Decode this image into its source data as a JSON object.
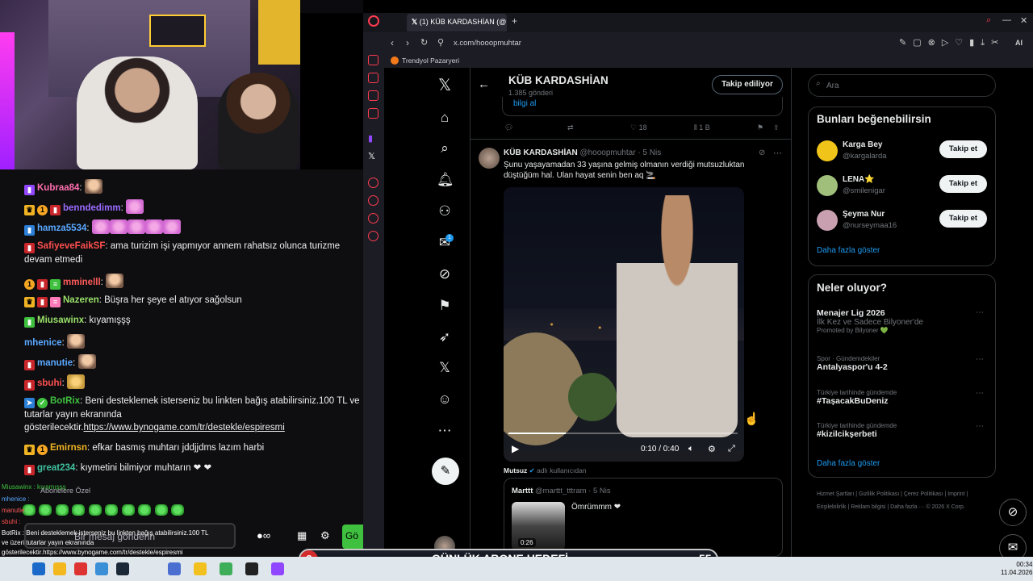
{
  "browser": {
    "tab_title": "(1) KÜB KARDASHİAN (@h",
    "url": "x.com/hooopmuhtar",
    "bookmark": "Trendyol Pazaryeri"
  },
  "profile": {
    "name": "KÜB KARDASHİAN",
    "posts": "1.385 gönderi",
    "follow_label": "Takip ediliyor",
    "prev_link": "bilgi al",
    "prev_likes": "18",
    "prev_views": "1 B"
  },
  "tweet": {
    "author": "KÜB KARDASHİAN",
    "handle": "@hooopmuhtar",
    "time": "· 5 Nis",
    "text": "Şunu yaşayamadan 33 yaşına gelmiş olmanın verdiği mutsuzluktan düştüğüm hal. Ulan hayat senin ben aq 🚬",
    "video_time": "0:10 / 0:40",
    "progress": 0.25
  },
  "quoted": {
    "label": "Mutsuz",
    "label_suffix": "adlı kullanıcıdan",
    "author": "Marttt",
    "handle": "@marttt_tttram",
    "time": "· 5 Nis",
    "text": "Ömrümmm ❤",
    "duration": "0:26"
  },
  "search": {
    "placeholder": "Ara"
  },
  "who_to_follow": {
    "title": "Bunları beğenebilirsin",
    "items": [
      {
        "name": "Karga Bey",
        "handle": "@kargalarda",
        "button": "Takip et",
        "color": "#f0c419"
      },
      {
        "name": "LENA⭐",
        "handle": "@smilenigar",
        "button": "Takip et",
        "color": "#9fbf7a"
      },
      {
        "name": "Şeyma Nur",
        "handle": "@nurseymaa16",
        "button": "Takip et",
        "color": "#c9a0b0"
      }
    ],
    "more": "Daha fazla göster"
  },
  "trends": {
    "title": "Neler oluyor?",
    "items": [
      {
        "context": "",
        "title": "Menajer Lig 2026",
        "sub": "İlk Kez ve Sadece Bilyoner'de",
        "extra": "Promoted by Bilyoner 💚"
      },
      {
        "context": "Spor · Gündemdekiler",
        "title": "Antalyaspor'u 4-2",
        "sub": "",
        "extra": ""
      },
      {
        "context": "Türkiye tarihinde gündemde",
        "title": "#TaşacakBuDeniz",
        "sub": "",
        "extra": ""
      },
      {
        "context": "Türkiye tarihinde gündemde",
        "title": "#kizilcikşerbeti",
        "sub": "",
        "extra": ""
      }
    ],
    "more": "Daha fazla göster"
  },
  "footer": "Hizmet Şartları | Gizlilik Politikası | Çerez Politikası | Imprint | Erişilebilirlik | Reklam bilgisi | Daha fazla ··· © 2026 X Corp.",
  "chat": {
    "lines": [
      {
        "user": "Kubraa84",
        "color": "#ff6fb0",
        "text": ":",
        "emotes": "face"
      },
      {
        "user": "benndedimm",
        "color": "#9b6bff",
        "text": ":",
        "emotes": "pink1"
      },
      {
        "user": "hamza5534",
        "color": "#5aa8ff",
        "text": ":",
        "emotes": "pink5"
      },
      {
        "user": "SafiyeveFaikSF",
        "color": "#ff4f4f",
        "text": ": ama turizim işi yapmıyor annem rahatsız olunca turizme devam etmedi"
      },
      {
        "user": "mminelll",
        "color": "#ff5a5a",
        "text": ":",
        "emotes": "face"
      },
      {
        "user": "Nazeren",
        "color": "#9ae06a",
        "text": ": Büşra her şeye el atıyor sağolsun"
      },
      {
        "user": "Miusawinx",
        "color": "#9ae06a",
        "text": ": kıyamışşş"
      },
      {
        "user": "mhenice",
        "color": "#5aa8ff",
        "text": ":",
        "emotes": "face"
      },
      {
        "user": "manutie",
        "color": "#5aa8ff",
        "text": ":",
        "emotes": "face"
      },
      {
        "user": "sbuhi",
        "color": "#ff4f4f",
        "text": ":",
        "emotes": "hands"
      },
      {
        "user": "BotRix",
        "color": "#3fc13f",
        "text": ": Beni desteklemek isterseniz bu linkten bağış atabilirsiniz.100 TL ve tutarlar yayın ekranında gösterilecektir.",
        "link": "https://www.bynogame.com/tr/destekle/espiresmi"
      },
      {
        "user": "Emirnsn",
        "color": "#f0b323",
        "text": ": efkar basmış muhtarı jddjjdms lazım harbi"
      },
      {
        "user": "great234",
        "color": "#3fc1a0",
        "text": ": kıymetini bilmiyor muhtarın ❤ ❤"
      }
    ],
    "subscribers_label": "Abonelere Özel",
    "message_placeholder": "Bir mesaj gönderin",
    "send_label": "Gö",
    "overlay_lines": [
      "Miusawinx : kıyamışşş",
      "mhenice :",
      "manutie :",
      "sbuhi :",
      "BotRix : Beni desteklemek isterseniz bu linkten bağış atabilirsiniz.100 TL",
      "ve üzeri tutarlar yayın ekranında",
      "gösterilecektir.https://www.bynogame.com/tr/destekle/espiresmi"
    ]
  },
  "banner": {
    "left": "2",
    "text": "GÜNLÜK ABONE HEDEFİ",
    "right": "55"
  },
  "clock": {
    "time": "00:34",
    "date": "11.04.2026"
  }
}
